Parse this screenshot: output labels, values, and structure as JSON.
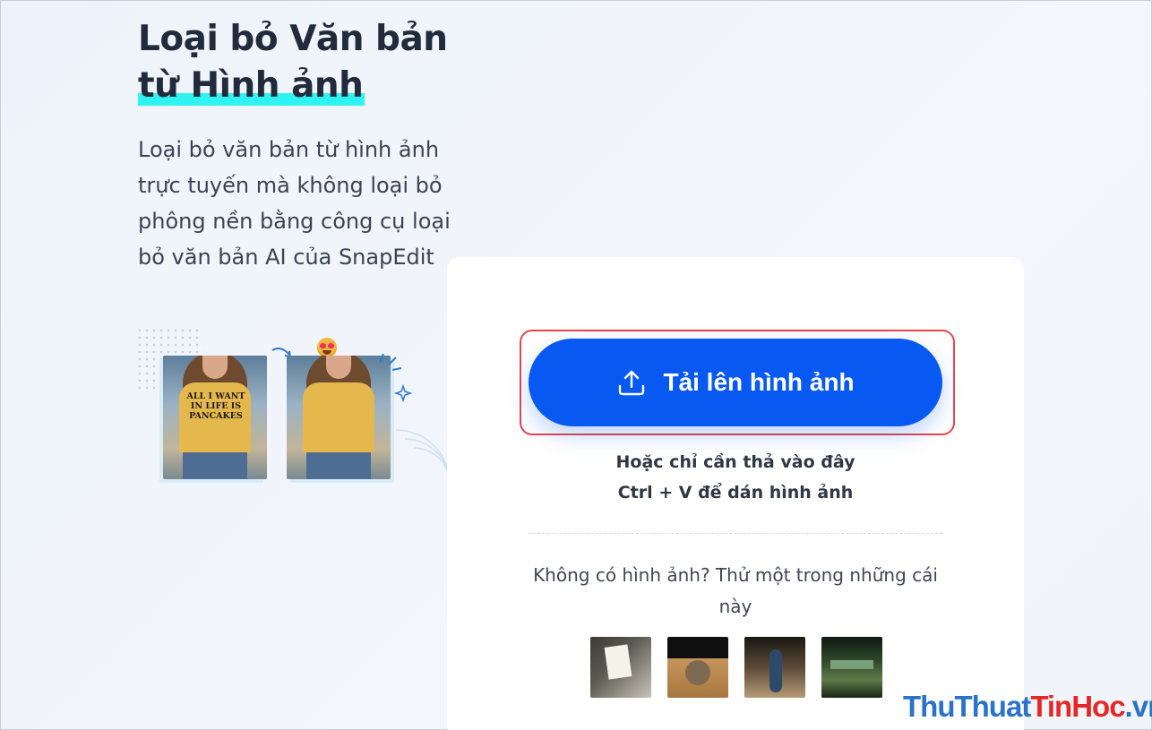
{
  "hero": {
    "title_line1": "Loại bỏ Văn bản",
    "title_line2": "từ Hình ảnh",
    "description": "Loại bỏ văn bản từ hình ảnh trực tuyến mà không loại bỏ phông nền bằng công cụ loại bỏ văn bản AI của SnapEdit"
  },
  "illustration": {
    "before_shirt_text": "ALL I WANT IN LIFE IS PANCAKES"
  },
  "upload": {
    "button_label": "Tải lên hình ảnh",
    "icon": "upload-icon",
    "drop_hint": "Hoặc chỉ cần thả vào đây",
    "paste_hint": "Ctrl + V để dán hình ảnh"
  },
  "samples": {
    "prompt": "Không có hình ảnh? Thử một trong những cái này",
    "count": 4
  },
  "watermark": {
    "part1": "Thu",
    "part2": "Thuat",
    "part3": "TinHoc",
    "part4": ".vn"
  },
  "colors": {
    "primary": "#0859f2",
    "highlight": "#2ff2f2",
    "focus_outline": "#e2464f"
  }
}
